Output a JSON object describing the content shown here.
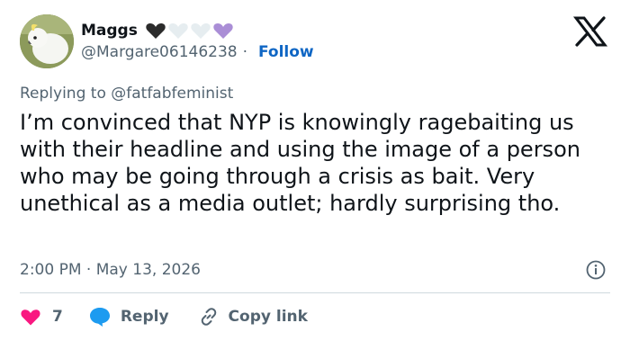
{
  "author": {
    "name": "Maggs",
    "handle": "@Margare06146238",
    "separator": "·",
    "follow_label": "Follow",
    "emoji_hearts": [
      {
        "icon": "black-heart-icon",
        "color": "#2b2b2b"
      },
      {
        "icon": "white-heart-icon",
        "color": "#e6edf0"
      },
      {
        "icon": "white-heart-icon",
        "color": "#e6edf0"
      },
      {
        "icon": "purple-heart-icon",
        "color": "#aa8ed6"
      }
    ]
  },
  "platform_icon": "x-logo-icon",
  "reply_context": {
    "prefix": "Replying to",
    "mention": "@fatfabfeminist"
  },
  "tweet": {
    "text": "I’m convinced that NYP is knowingly ragebaiting us with their headline and using the image of a person who may be going through a crisis as bait. Very unethical as a media outlet; hardly surprising tho."
  },
  "meta": {
    "time": "2:00 PM",
    "separator": "·",
    "date": "May 13, 2026"
  },
  "actions": {
    "like_count": "7",
    "reply_label": "Reply",
    "copy_link_label": "Copy link"
  },
  "colors": {
    "like": "#f91880",
    "reply": "#1d9bf0",
    "secondary_text": "#536471",
    "follow": "#0f66c4"
  }
}
